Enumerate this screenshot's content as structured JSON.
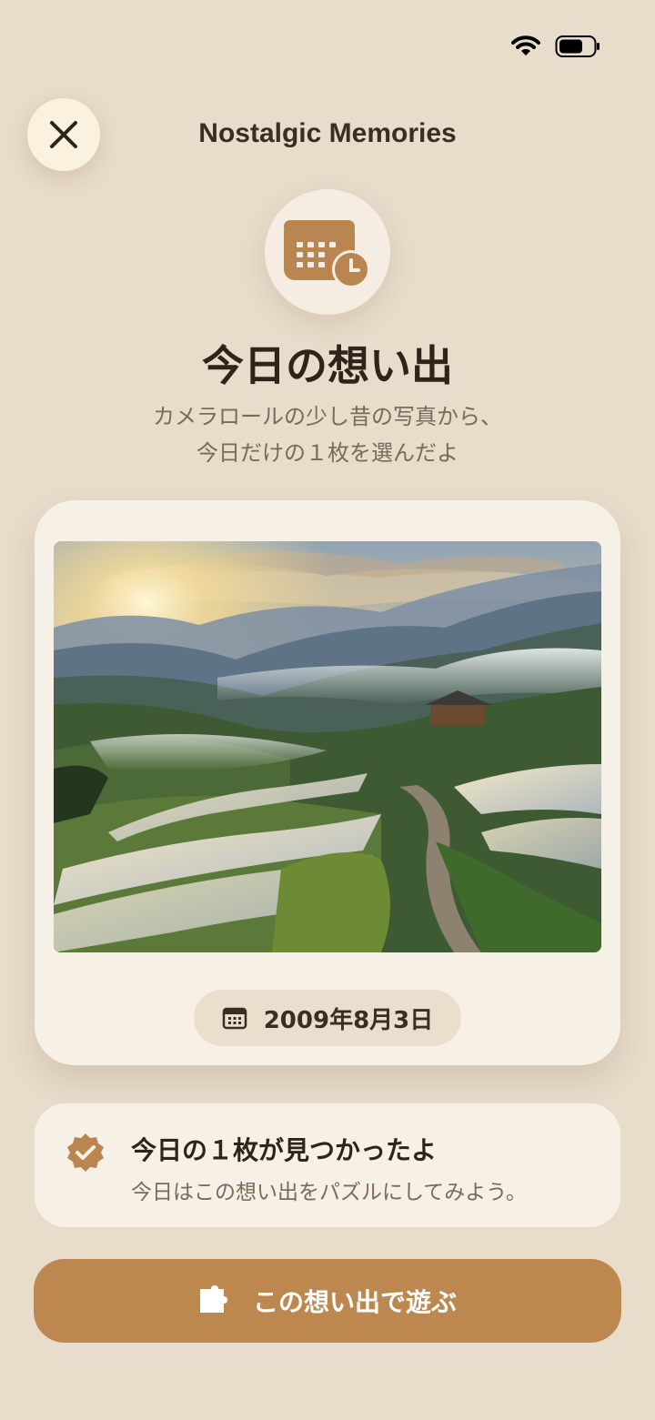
{
  "app": {
    "title": "Nostalgic Memories"
  },
  "hero": {
    "heading": "今日の想い出",
    "subtitle_line1": "カメラロールの少し昔の写真から、",
    "subtitle_line2": "今日だけの１枚を選んだよ"
  },
  "photo": {
    "date": "2009年8月3日",
    "icon": "calendar-icon"
  },
  "info": {
    "title": "今日の１枚が見つかったよ",
    "text": "今日はこの想い出をパズルにしてみよう。",
    "icon": "verified-badge-icon"
  },
  "action": {
    "label": "この想い出で遊ぶ",
    "icon": "puzzle-icon"
  },
  "colors": {
    "background": "#e8dccb",
    "accent": "#bd8750",
    "card": "#f6f0e6"
  }
}
